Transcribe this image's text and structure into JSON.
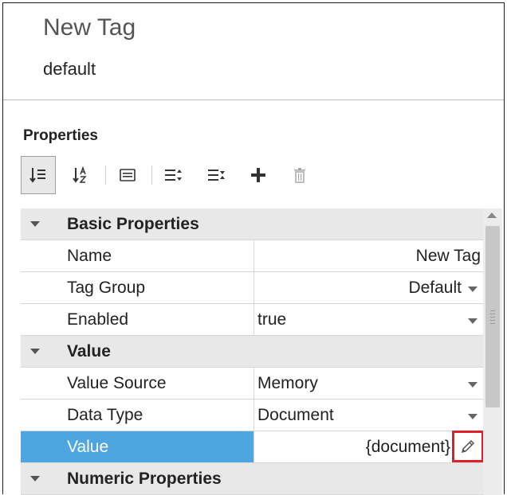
{
  "header": {
    "title": "New Tag",
    "subtitle": "default"
  },
  "properties": {
    "title": "Properties",
    "toolbar": [
      {
        "name": "sort-categorized-icon",
        "active": true
      },
      {
        "name": "sort-alphabetical-icon",
        "active": false
      },
      {
        "name": "show-description-icon",
        "active": false
      },
      {
        "name": "expand-all-icon",
        "active": false
      },
      {
        "name": "collapse-all-icon",
        "active": false
      },
      {
        "name": "add-icon",
        "active": false
      },
      {
        "name": "delete-icon",
        "active": false
      }
    ],
    "categories": {
      "basic": "Basic Properties",
      "value": "Value",
      "numeric": "Numeric Properties"
    },
    "rows": {
      "name": {
        "label": "Name",
        "value": "New Tag"
      },
      "tag_group": {
        "label": "Tag Group",
        "value": "Default"
      },
      "enabled": {
        "label": "Enabled",
        "value": "true"
      },
      "value_source": {
        "label": "Value Source",
        "value": "Memory"
      },
      "data_type": {
        "label": "Data Type",
        "value": "Document"
      },
      "value": {
        "label": "Value",
        "value": "{document}"
      }
    }
  },
  "colors": {
    "selected_row": "#4da6e0",
    "highlight_box": "#e0212c",
    "category_bg": "#e8e8e8"
  }
}
